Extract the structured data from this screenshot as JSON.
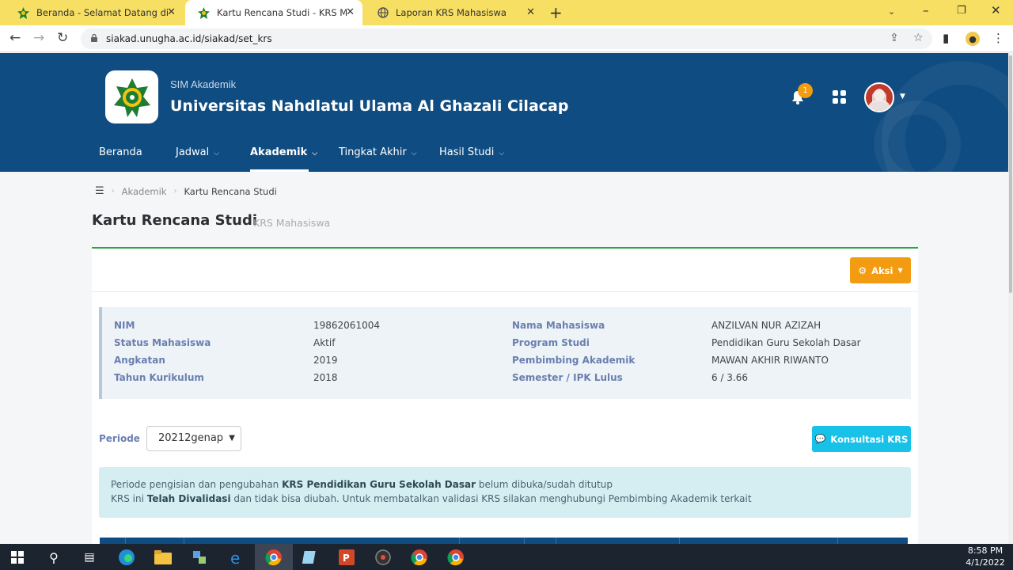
{
  "browser": {
    "tabs": [
      {
        "title": "Beranda - Selamat Datang di Sist",
        "active": false
      },
      {
        "title": "Kartu Rencana Studi - KRS Mahas",
        "active": true
      },
      {
        "title": "Laporan KRS Mahasiswa",
        "active": false
      }
    ],
    "url": "siakad.unugha.ac.id/siakad/set_krs"
  },
  "header": {
    "app_name": "SIM Akademik",
    "university": "Universitas Nahdlatul Ulama Al Ghazali Cilacap",
    "notification_count": "1",
    "menu": [
      {
        "label": "Beranda",
        "has_dropdown": false
      },
      {
        "label": "Jadwal",
        "has_dropdown": true
      },
      {
        "label": "Akademik",
        "has_dropdown": true,
        "active": true
      },
      {
        "label": "Tingkat Akhir",
        "has_dropdown": true
      },
      {
        "label": "Hasil Studi",
        "has_dropdown": true
      }
    ]
  },
  "breadcrumb": {
    "section": "Akademik",
    "current": "Kartu Rencana Studi"
  },
  "page": {
    "title": "Kartu Rencana Studi",
    "subtitle": "KRS Mahasiswa"
  },
  "actions": {
    "aksi_label": "Aksi",
    "konsultasi_label": "Konsultasi KRS"
  },
  "student": {
    "left": [
      {
        "label": "NIM",
        "value": "19862061004"
      },
      {
        "label": "Status Mahasiswa",
        "value": "Aktif"
      },
      {
        "label": "Angkatan",
        "value": "2019"
      },
      {
        "label": "Tahun Kurikulum",
        "value": "2018"
      }
    ],
    "right": [
      {
        "label": "Nama Mahasiswa",
        "value": "ANZILVAN NUR AZIZAH"
      },
      {
        "label": "Program Studi",
        "value": "Pendidikan Guru Sekolah Dasar"
      },
      {
        "label": "Pembimbing Akademik",
        "value": "MAWAN AKHIR RIWANTO"
      },
      {
        "label": "Semester / IPK Lulus",
        "value": "6 / 3.66"
      }
    ]
  },
  "periode": {
    "label": "Periode",
    "selected": "20212genap"
  },
  "notice": {
    "line1_pre": "Periode pengisian dan pengubahan ",
    "line1_bold": "KRS Pendidikan Guru Sekolah Dasar",
    "line1_post": " belum dibuka/sudah ditutup",
    "line2_pre": "KRS ini ",
    "line2_bold": "Telah Divalidasi",
    "line2_post": " dan tidak bisa diubah. Untuk membatalkan validasi KRS silakan menghubungi Pembimbing Akademik terkait"
  },
  "taskbar": {
    "time": "8:58 PM",
    "date": "4/1/2022"
  },
  "colors": {
    "header_bg": "#0f4c81",
    "accent_green": "#28a745",
    "aksi_orange": "#f39c12",
    "konsultasi_cyan": "#17c1e8",
    "tab_bar_yellow": "#f6df62"
  }
}
